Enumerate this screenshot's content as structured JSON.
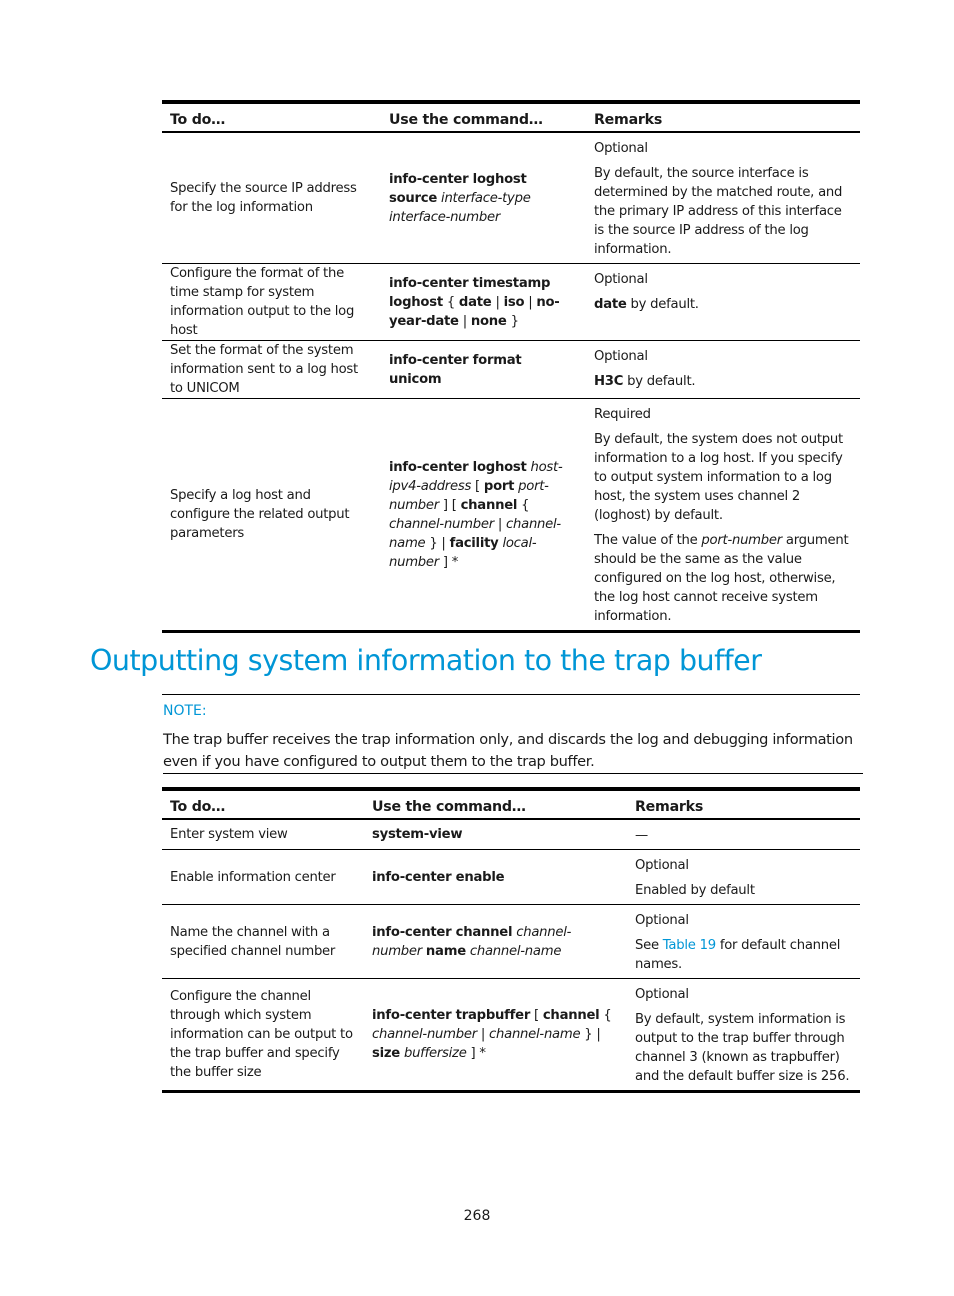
{
  "table1": {
    "headers": [
      "To do…",
      "Use the command…",
      "Remarks"
    ],
    "rows": [
      {
        "task": "Specify the source IP address for the log information",
        "command": [
          {
            "t": "info-center loghost source",
            "s": "b"
          },
          {
            "t": " ",
            "s": ""
          },
          {
            "t": "interface-type",
            "s": "i"
          },
          {
            "t": " ",
            "s": ""
          },
          {
            "t": "interface-number",
            "s": "i"
          }
        ],
        "remarks": [
          [
            {
              "t": "Optional",
              "s": ""
            }
          ],
          [
            {
              "t": "By default, the source interface is determined by the matched route, and the primary IP address of this interface is the source IP address of the log information.",
              "s": ""
            }
          ]
        ]
      },
      {
        "task": "Configure the format of the time stamp for system information output to the log host",
        "command": [
          {
            "t": "info-center timestamp loghost",
            "s": "b"
          },
          {
            "t": " { ",
            "s": ""
          },
          {
            "t": "date",
            "s": "b"
          },
          {
            "t": " | ",
            "s": ""
          },
          {
            "t": "iso",
            "s": "b"
          },
          {
            "t": " | ",
            "s": ""
          },
          {
            "t": "no-year-date",
            "s": "b"
          },
          {
            "t": " | ",
            "s": ""
          },
          {
            "t": "none",
            "s": "b"
          },
          {
            "t": " }",
            "s": ""
          }
        ],
        "remarks": [
          [
            {
              "t": "Optional",
              "s": ""
            }
          ],
          [
            {
              "t": "date",
              "s": "b"
            },
            {
              "t": " by default.",
              "s": ""
            }
          ]
        ]
      },
      {
        "task": "Set the format of the system information sent to a log host to UNICOM",
        "command": [
          {
            "t": "info-center format unicom",
            "s": "b"
          }
        ],
        "remarks": [
          [
            {
              "t": "Optional",
              "s": ""
            }
          ],
          [
            {
              "t": "H3C",
              "s": "b"
            },
            {
              "t": " by default.",
              "s": ""
            }
          ]
        ]
      },
      {
        "task": "Specify a log host and configure the related output parameters",
        "command": [
          {
            "t": "info-center loghost",
            "s": "b"
          },
          {
            "t": " ",
            "s": ""
          },
          {
            "t": "host-ipv4-address",
            "s": "i"
          },
          {
            "t": "  [ ",
            "s": ""
          },
          {
            "t": "port",
            "s": "b"
          },
          {
            "t": " ",
            "s": ""
          },
          {
            "t": "port-number",
            "s": "i"
          },
          {
            "t": " ] [ ",
            "s": ""
          },
          {
            "t": "channel",
            "s": "b"
          },
          {
            "t": " { ",
            "s": ""
          },
          {
            "t": "channel-number",
            "s": "i"
          },
          {
            "t": " | ",
            "s": ""
          },
          {
            "t": "channel-name",
            "s": "i"
          },
          {
            "t": " } | ",
            "s": ""
          },
          {
            "t": "facility",
            "s": "b"
          },
          {
            "t": " ",
            "s": ""
          },
          {
            "t": "local-number",
            "s": "i"
          },
          {
            "t": " ] *",
            "s": ""
          }
        ],
        "remarks": [
          [
            {
              "t": "Required",
              "s": ""
            }
          ],
          [
            {
              "t": "By default, the system does not output information to a log host. If you specify to output system information to a log host, the system uses channel 2 (loghost) by default.",
              "s": ""
            }
          ],
          [
            {
              "t": "The value of the ",
              "s": ""
            },
            {
              "t": "port-number",
              "s": "i"
            },
            {
              "t": " argument should be the same as the value configured on the log host, otherwise, the log host cannot receive system information.",
              "s": ""
            }
          ]
        ]
      }
    ]
  },
  "section": {
    "heading": "Outputting system information to the trap buffer",
    "note_label": "NOTE:",
    "note_text": "The trap buffer receives the trap information only, and discards the log and debugging information even if you have configured to output them to the trap buffer."
  },
  "table2": {
    "headers": [
      "To do…",
      "Use the command…",
      "Remarks"
    ],
    "rows": [
      {
        "task": "Enter system view",
        "command": [
          {
            "t": "system-view",
            "s": "b"
          }
        ],
        "remarks": [
          [
            {
              "t": "—",
              "s": ""
            }
          ]
        ]
      },
      {
        "task": "Enable information center",
        "command": [
          {
            "t": "info-center enable",
            "s": "b"
          }
        ],
        "remarks": [
          [
            {
              "t": "Optional",
              "s": ""
            }
          ],
          [
            {
              "t": "Enabled by default",
              "s": ""
            }
          ]
        ]
      },
      {
        "task": "Name the channel with a specified channel number",
        "command": [
          {
            "t": "info-center channel",
            "s": "b"
          },
          {
            "t": " ",
            "s": ""
          },
          {
            "t": "channel-number",
            "s": "i"
          },
          {
            "t": " ",
            "s": ""
          },
          {
            "t": "name",
            "s": "b"
          },
          {
            "t": " ",
            "s": ""
          },
          {
            "t": "channel-name",
            "s": "i"
          }
        ],
        "remarks": [
          [
            {
              "t": "Optional",
              "s": ""
            }
          ],
          [
            {
              "t": "See ",
              "s": ""
            },
            {
              "t": "Table 19",
              "s": "link"
            },
            {
              "t": " for default channel names.",
              "s": ""
            }
          ]
        ]
      },
      {
        "task": "Configure the channel through which system information can be output to the trap buffer and specify the buffer size",
        "command": [
          {
            "t": "info-center trapbuffer",
            "s": "b"
          },
          {
            "t": " [ ",
            "s": ""
          },
          {
            "t": "channel",
            "s": "b"
          },
          {
            "t": " { ",
            "s": ""
          },
          {
            "t": "channel-number",
            "s": "i"
          },
          {
            "t": " | ",
            "s": "i"
          },
          {
            "t": "channel-name",
            "s": "i"
          },
          {
            "t": " } ",
            "s": ""
          },
          {
            "t": "|",
            "s": "i"
          },
          {
            "t": " ",
            "s": ""
          },
          {
            "t": "size",
            "s": "b"
          },
          {
            "t": " ",
            "s": ""
          },
          {
            "t": "buffersize",
            "s": "i"
          },
          {
            "t": " ] *",
            "s": ""
          }
        ],
        "remarks": [
          [
            {
              "t": "Optional",
              "s": ""
            }
          ],
          [
            {
              "t": "By default, system information is output to the trap buffer through channel 3 (known as trapbuffer) and the default buffer size is 256.",
              "s": ""
            }
          ]
        ]
      }
    ]
  },
  "footer": {
    "page_number": "268"
  },
  "colors": {
    "accent": "#0096d6",
    "text": "#1a1a1a",
    "rule": "#000000"
  }
}
